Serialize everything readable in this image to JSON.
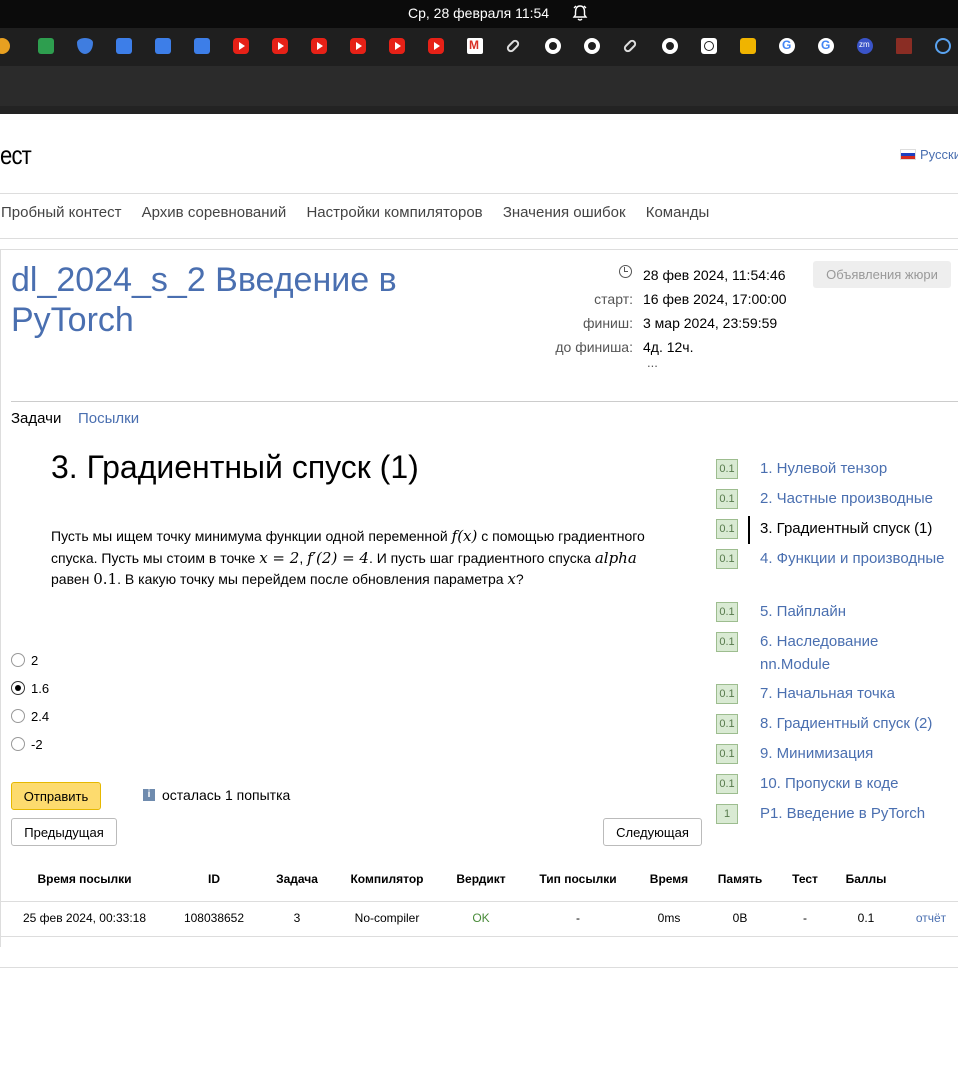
{
  "os": {
    "clock": "Ср, 28 февраля  11:54"
  },
  "bookmarks": [
    "infinity-icon",
    "sheets-icon",
    "feather-icon",
    "cube-icon",
    "cube-icon",
    "cube-icon",
    "youtube-icon",
    "youtube-icon",
    "youtube-icon",
    "youtube-icon",
    "youtube-icon",
    "youtube-icon",
    "gmail-icon",
    "link-icon",
    "github-icon",
    "github-icon",
    "link-icon",
    "github-icon",
    "clock-icon",
    "mail-icon",
    "google-icon",
    "google-icon",
    "zoom-icon",
    "castle-icon",
    "swirl-icon"
  ],
  "site": {
    "logo": "ест",
    "language": "Русски"
  },
  "menu": [
    "Пробный контест",
    "Архив соревнований",
    "Настройки компиляторов",
    "Значения ошибок",
    "Команды"
  ],
  "contest": {
    "title": "dl_2024_s_2 Введение в PyTorch",
    "info_labels": {
      "start": "старт:",
      "finish": "финиш:",
      "remaining": "до финиша:"
    },
    "info_values": {
      "now": "28 фев 2024, 11:54:46",
      "start": "16 фев 2024, 17:00:00",
      "finish": "3 мар 2024, 23:59:59",
      "remaining": "4д. 12ч."
    },
    "more": "...",
    "jury_button": "Объявления жюри"
  },
  "tabs": {
    "problems": "Задачи",
    "submissions": "Посылки"
  },
  "problem": {
    "title": "3. Градиентный спуск (1)",
    "statement": {
      "t1": "Пусть мы ищем точку минимума функции одной переменной ",
      "m1": "f(x)",
      "t2": " с помощью градиентного спуска. Пусть мы стоим в точке ",
      "m2": "x = 2",
      "t3": ", ",
      "m3": "f′(2) = 4",
      "t4": ". И пусть шаг градиентного спуска ",
      "m4": "alpha",
      "t5": " равен ",
      "m5": "0.1",
      "t6": ". В какую точку мы перейдем после обновления параметра ",
      "m6": "x",
      "t7": "?"
    },
    "options": [
      {
        "label": "2",
        "checked": false
      },
      {
        "label": "1.6",
        "checked": true
      },
      {
        "label": "2.4",
        "checked": false
      },
      {
        "label": "-2",
        "checked": false
      }
    ],
    "submit_label": "Отправить",
    "attempts_text": "осталась 1 попытка",
    "prev_label": "Предыдущая",
    "next_label": "Следующая"
  },
  "sidebar": [
    {
      "score": "0.1",
      "label": "1. Нулевой тензор"
    },
    {
      "score": "0.1",
      "label": "2. Частные производные"
    },
    {
      "score": "0.1",
      "label": "3. Градиентный спуск (1)",
      "current": true
    },
    {
      "score": "0.1",
      "label": "4. Функции и производные"
    },
    {
      "score": "0.1",
      "label": "5. Пайплайн"
    },
    {
      "score": "0.1",
      "label": "6. Наследование nn.Module"
    },
    {
      "score": "0.1",
      "label": "7. Начальная точка"
    },
    {
      "score": "0.1",
      "label": "8. Градиентный спуск (2)"
    },
    {
      "score": "0.1",
      "label": "9. Минимизация"
    },
    {
      "score": "0.1",
      "label": "10. Пропуски в коде"
    },
    {
      "score": "1",
      "label": "P1. Введение в PyTorch"
    }
  ],
  "table": {
    "headers": [
      "Время посылки",
      "ID",
      "Задача",
      "Компилятор",
      "Вердикт",
      "Тип посылки",
      "Время",
      "Память",
      "Тест",
      "Баллы"
    ],
    "rows": [
      {
        "time": "25 фев 2024, 00:33:18",
        "id": "108038652",
        "task": "3",
        "compiler": "No-compiler",
        "verdict": "OK",
        "type": "-",
        "runtime": "0ms",
        "memory": "0B",
        "test": "-",
        "score": "0.1",
        "report": "отчёт"
      }
    ]
  }
}
